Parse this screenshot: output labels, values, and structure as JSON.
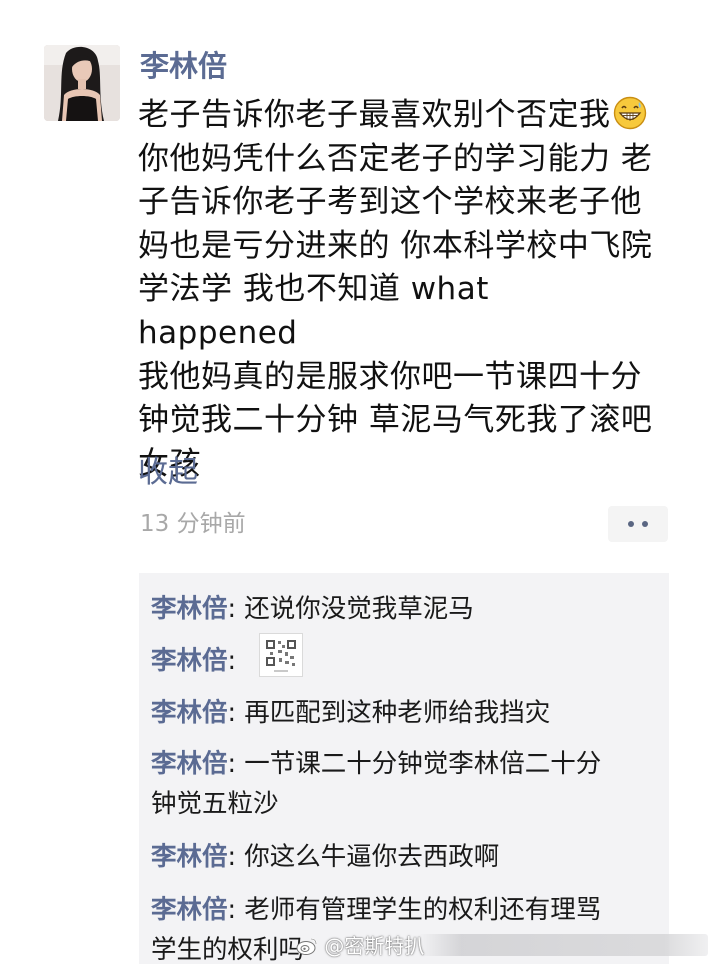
{
  "post": {
    "author": "李林倍",
    "body_line1": "老子告诉你老子最喜欢别个否定我",
    "body_rest": "你他妈凭什么否定老子的学习能力 老\n子告诉你老子考到这个学校来老子他\n妈也是亏分进来的 你本科学校中飞院\n学法学 我也不知道 what happened\n我他妈真的是服求你吧一节课四十分\n钟觉我二十分钟 草泥马气死我了滚吧\n女孩",
    "emoji": "grinning-face-with-sweat",
    "collapse_label": "收起",
    "time": "13 分钟前"
  },
  "comments": [
    {
      "name": "李林倍",
      "separator": ": ",
      "text": "还说你没觉我草泥马"
    },
    {
      "name": "李林倍",
      "separator": ": ",
      "text": "",
      "image": "qr-code-image"
    },
    {
      "name": "李林倍",
      "separator": ": ",
      "text": "再匹配到这种老师给我挡灾"
    },
    {
      "name": "李林倍",
      "separator": ": ",
      "text": "一节课二十分钟觉李林倍二十分\n钟觉五粒沙"
    },
    {
      "name": "李林倍",
      "separator": ": ",
      "text": "你这么牛逼你去西政啊"
    },
    {
      "name": "李林倍",
      "separator": ": ",
      "text": "老师有管理学生的权利还有理骂\n学生的权利吗"
    }
  ],
  "watermark": {
    "icon": "weibo-logo-icon",
    "text": "@密斯特扒"
  },
  "colors": {
    "name_blue": "#5b6b93",
    "time_gray": "#a8a8a8",
    "comment_bg": "#f3f3f5"
  }
}
